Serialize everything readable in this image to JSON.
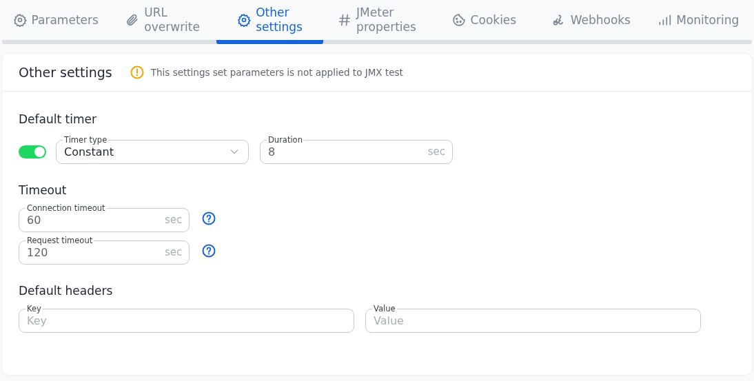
{
  "tabs": [
    {
      "label": "Parameters",
      "selected": false
    },
    {
      "label": "URL overwrite",
      "selected": false
    },
    {
      "label": "Other settings",
      "selected": true
    },
    {
      "label": "JMeter properties",
      "selected": false
    },
    {
      "label": "Cookies",
      "selected": false
    },
    {
      "label": "Webhooks",
      "selected": false
    },
    {
      "label": "Monitoring",
      "selected": false
    }
  ],
  "panel": {
    "title": "Other settings",
    "warning": "This settings set parameters is not applied to JMX test"
  },
  "default_timer": {
    "heading": "Default timer",
    "enabled": true,
    "timer_type": {
      "label": "Timer type",
      "value": "Constant"
    },
    "duration": {
      "label": "Duration",
      "value": "8",
      "unit": "sec"
    }
  },
  "timeout": {
    "heading": "Timeout",
    "fields": [
      {
        "label": "Connection timeout",
        "value": "60",
        "unit": "sec"
      },
      {
        "label": "Request timeout",
        "value": "120",
        "unit": "sec"
      }
    ]
  },
  "default_headers": {
    "heading": "Default headers",
    "fields": [
      {
        "label": "Key",
        "placeholder": "Key"
      },
      {
        "label": "Value",
        "placeholder": "Value"
      }
    ]
  }
}
